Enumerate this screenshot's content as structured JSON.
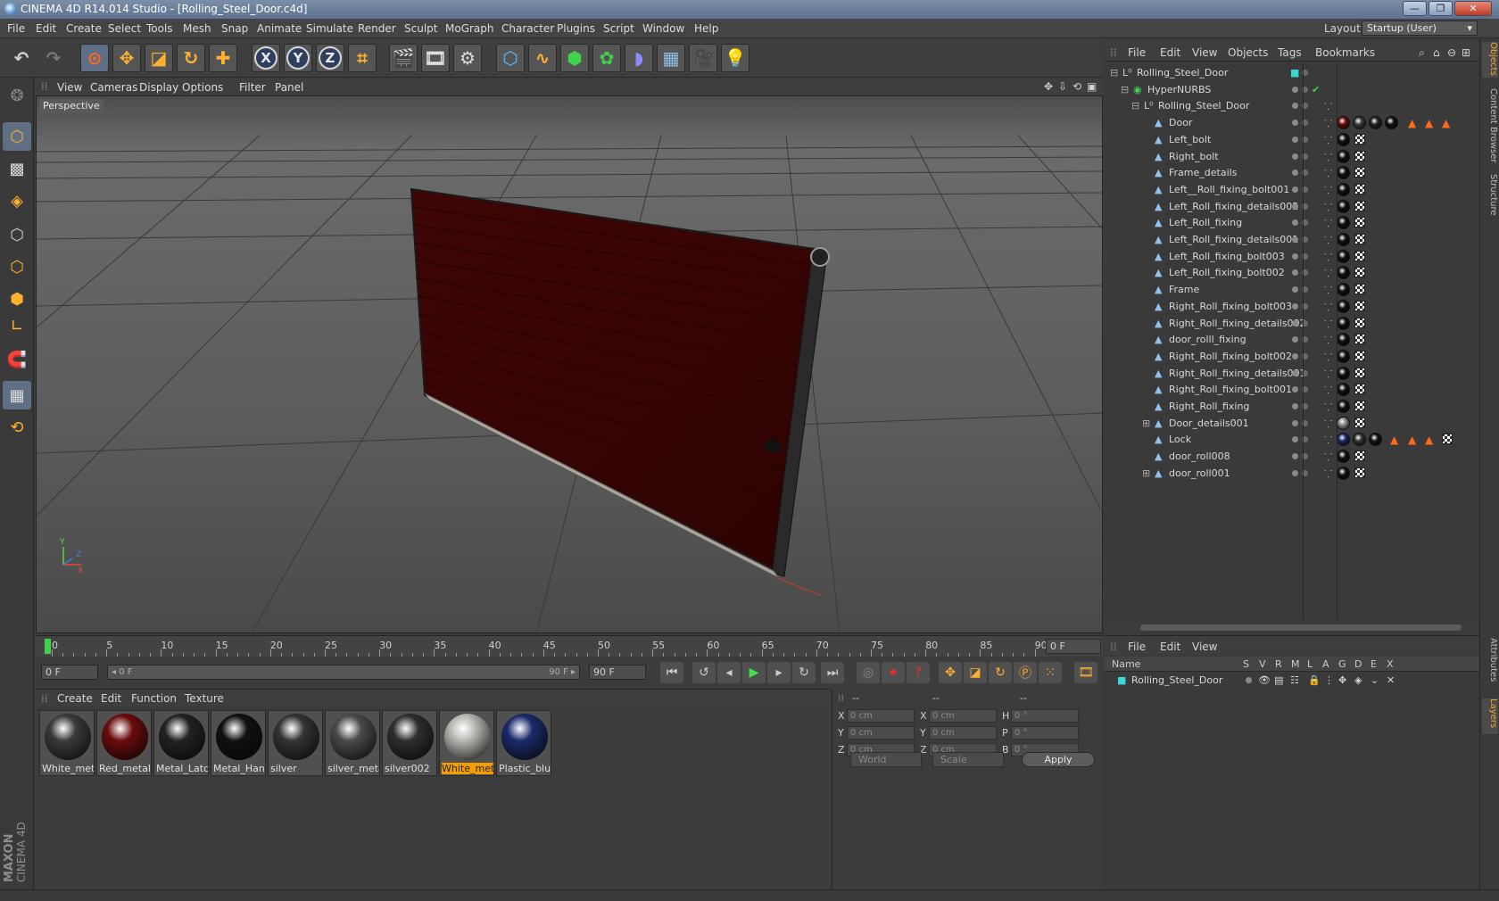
{
  "window": {
    "title": "CINEMA 4D R14.014 Studio - [Rolling_Steel_Door.c4d]"
  },
  "menu": [
    "File",
    "Edit",
    "Create",
    "Select",
    "Tools",
    "Mesh",
    "Snap",
    "Animate",
    "Simulate",
    "Render",
    "Sculpt",
    "MoGraph",
    "Character",
    "Plugins",
    "Script",
    "Window",
    "Help"
  ],
  "layout": {
    "label": "Layout:",
    "value": "Startup (User)"
  },
  "viewport": {
    "menu": [
      "View",
      "Cameras",
      "Display",
      "Options",
      "Filter",
      "Panel"
    ],
    "label": "Perspective"
  },
  "timeline": {
    "ticks": [
      "0",
      "5",
      "10",
      "15",
      "20",
      "25",
      "30",
      "35",
      "40",
      "45",
      "50",
      "55",
      "60",
      "65",
      "70",
      "75",
      "80",
      "85",
      "90"
    ],
    "end_field": "0 F",
    "start_field": "0 F",
    "range_start": "◂ 0 F",
    "range_end": "90 F ▸",
    "max_field": "90 F"
  },
  "materials": {
    "menu": [
      "Create",
      "Edit",
      "Function",
      "Texture"
    ],
    "items": [
      {
        "name": "White_met",
        "color": "#3a3a3a",
        "selected": false
      },
      {
        "name": "Red_metal_",
        "color": "#6a0b0b",
        "selected": false
      },
      {
        "name": "Metal_Latcl",
        "color": "#222222",
        "selected": false
      },
      {
        "name": "Metal_Han",
        "color": "#111111",
        "selected": false
      },
      {
        "name": "silver",
        "color": "#333333",
        "selected": false
      },
      {
        "name": "silver_meta",
        "color": "#4a4a4a",
        "selected": false
      },
      {
        "name": "silver002",
        "color": "#2e2e2e",
        "selected": false
      },
      {
        "name": "White_met",
        "color": "#b8b6b0",
        "selected": true
      },
      {
        "name": "Plastic_blu",
        "color": "#1a2a6a",
        "selected": false
      }
    ]
  },
  "coords": {
    "col_headers": [
      "--",
      "--",
      "--"
    ],
    "rows": [
      {
        "a": "X",
        "av": "0 cm",
        "b": "X",
        "bv": "0 cm",
        "c": "H",
        "cv": "0 °"
      },
      {
        "a": "Y",
        "av": "0 cm",
        "b": "Y",
        "bv": "0 cm",
        "c": "P",
        "cv": "0 °"
      },
      {
        "a": "Z",
        "av": "0 cm",
        "b": "Z",
        "bv": "0 cm",
        "c": "B",
        "cv": "0 °"
      }
    ],
    "mode1": "World",
    "mode2": "Scale",
    "apply": "Apply"
  },
  "objects": {
    "menu": [
      "File",
      "Edit",
      "View",
      "Objects",
      "Tags",
      "Bookmarks"
    ],
    "rows": [
      {
        "name": "Rolling_Steel_Door",
        "level": 0,
        "tags": "root"
      },
      {
        "name": "HyperNURBS",
        "level": 1,
        "tags": "nurbs"
      },
      {
        "name": "Rolling_Steel_Door",
        "level": 2,
        "tags": "null"
      },
      {
        "name": "Door",
        "level": 3,
        "tags": "door"
      },
      {
        "name": "Left_bolt",
        "level": 3,
        "tags": "std"
      },
      {
        "name": "Right_bolt",
        "level": 3,
        "tags": "std"
      },
      {
        "name": "Frame_details",
        "level": 3,
        "tags": "std"
      },
      {
        "name": "Left__Roll_fixing_bolt001",
        "level": 3,
        "tags": "std"
      },
      {
        "name": "Left_Roll_fixing_details002",
        "level": 3,
        "tags": "std"
      },
      {
        "name": "Left_Roll_fixing",
        "level": 3,
        "tags": "std"
      },
      {
        "name": "Left_Roll_fixing_details001",
        "level": 3,
        "tags": "std"
      },
      {
        "name": "Left_Roll_fixing_bolt003",
        "level": 3,
        "tags": "std"
      },
      {
        "name": "Left_Roll_fixing_bolt002",
        "level": 3,
        "tags": "std"
      },
      {
        "name": "Frame",
        "level": 3,
        "tags": "std"
      },
      {
        "name": "Right_Roll_fixing_bolt003",
        "level": 3,
        "tags": "std"
      },
      {
        "name": "Right_Roll_fixing_details002",
        "level": 3,
        "tags": "std"
      },
      {
        "name": "door_rolll_fixing",
        "level": 3,
        "tags": "std"
      },
      {
        "name": "Right_Roll_fixing_bolt002",
        "level": 3,
        "tags": "std"
      },
      {
        "name": "Right_Roll_fixing_details001",
        "level": 3,
        "tags": "std"
      },
      {
        "name": "Right_Roll_fixing_bolt001",
        "level": 3,
        "tags": "std"
      },
      {
        "name": "Right_Roll_fixing",
        "level": 3,
        "tags": "std"
      },
      {
        "name": "Door_details001",
        "level": 3,
        "tags": "grey"
      },
      {
        "name": "Lock",
        "level": 3,
        "tags": "lock"
      },
      {
        "name": "door_roll008",
        "level": 3,
        "tags": "std"
      },
      {
        "name": "door_roll001",
        "level": 3,
        "tags": "std"
      }
    ]
  },
  "layers": {
    "menu": [
      "File",
      "Edit",
      "View"
    ],
    "headers": [
      "Name",
      "S",
      "V",
      "R",
      "M",
      "L",
      "A",
      "G",
      "D",
      "E",
      "X"
    ],
    "row": "Rolling_Steel_Door"
  },
  "right_tabs": [
    "Objects",
    "Content Browser",
    "Structure",
    "Attributes",
    "Layers"
  ],
  "colors": {
    "door": "#4a0606",
    "accent": "#f29d00",
    "selection": "#5f6f86"
  }
}
